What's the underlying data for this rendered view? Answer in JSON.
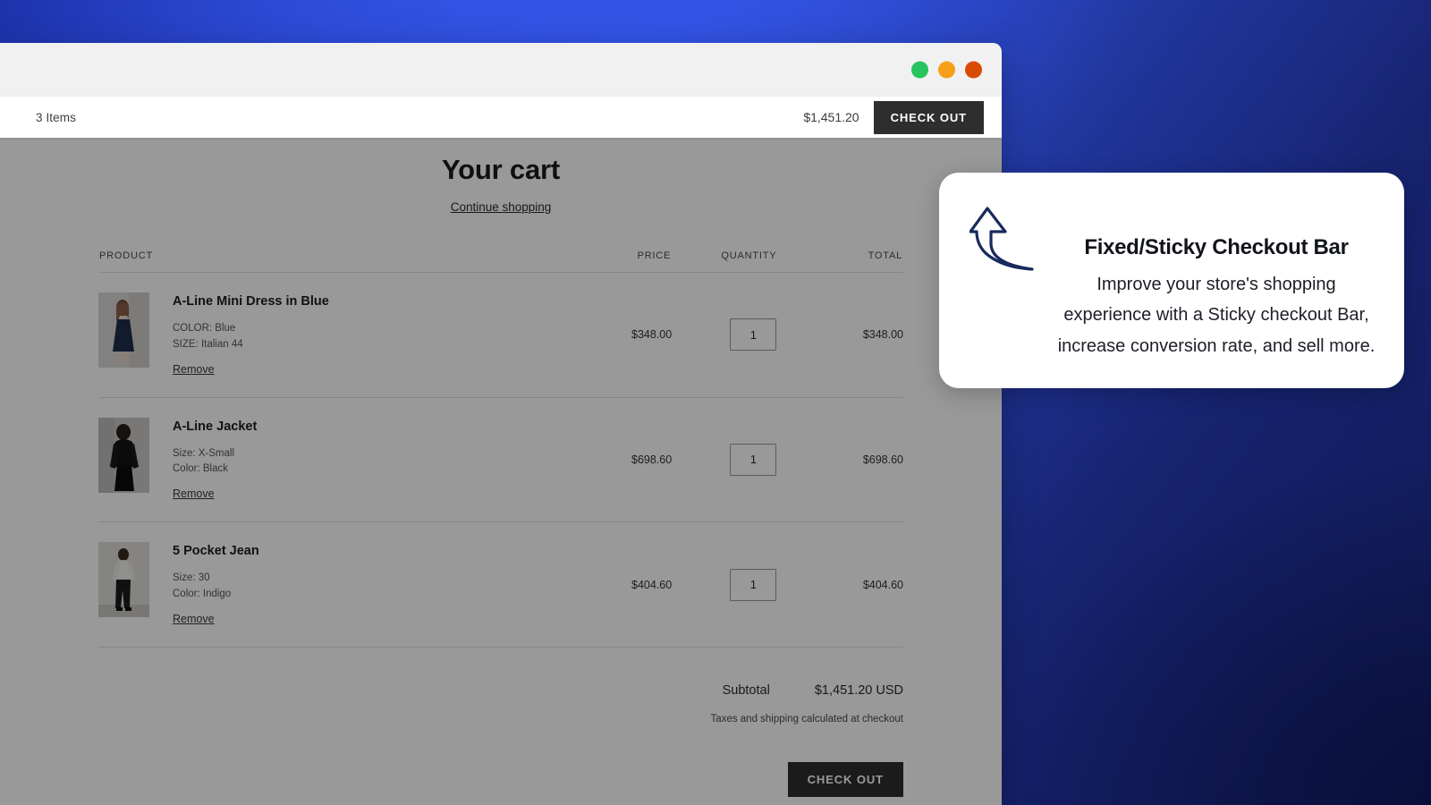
{
  "background": {
    "gradient_from": "#2f4ee0",
    "gradient_to": "#101a52"
  },
  "browser": {
    "window_controls": [
      {
        "name": "minimize-dot",
        "color": "#27c45f"
      },
      {
        "name": "maximize-dot",
        "color": "#f79f19"
      },
      {
        "name": "close-dot",
        "color": "#d94b02"
      }
    ]
  },
  "sticky_bar": {
    "items_count": "3 Items",
    "total": "$1,451.20",
    "checkout_label": "CHECK OUT",
    "checkout_bg": "#2e2e2e"
  },
  "cart": {
    "title": "Your cart",
    "continue_shopping": "Continue shopping",
    "columns": {
      "product": "PRODUCT",
      "price": "PRICE",
      "quantity": "QUANTITY",
      "total": "TOTAL"
    },
    "items": [
      {
        "title": "A-Line Mini Dress in Blue",
        "variant_1": "COLOR: Blue",
        "variant_2": "SIZE: Italian 44",
        "remove_label": "Remove",
        "price": "$348.00",
        "quantity": "1",
        "line_total": "$348.00",
        "thumb": "dress-navy"
      },
      {
        "title": "A-Line Jacket",
        "variant_1": "Size: X-Small",
        "variant_2": "Color: Black",
        "remove_label": "Remove",
        "price": "$698.60",
        "quantity": "1",
        "line_total": "$698.60",
        "thumb": "jacket-black"
      },
      {
        "title": "5 Pocket Jean",
        "variant_1": "Size: 30",
        "variant_2": "Color: Indigo",
        "remove_label": "Remove",
        "price": "$404.60",
        "quantity": "1",
        "line_total": "$404.60",
        "thumb": "jean-indigo"
      }
    ],
    "subtotal_label": "Subtotal",
    "subtotal_value": "$1,451.20 USD",
    "tax_note": "Taxes and shipping calculated at checkout",
    "checkout_label": "CHECK OUT"
  },
  "callout": {
    "icon": "curved-up-arrow-icon",
    "icon_color": "#182a5c",
    "title": "Fixed/Sticky Checkout Bar",
    "text": "Improve your store's shopping experience with a Sticky checkout Bar, increase conversion rate, and sell more."
  }
}
